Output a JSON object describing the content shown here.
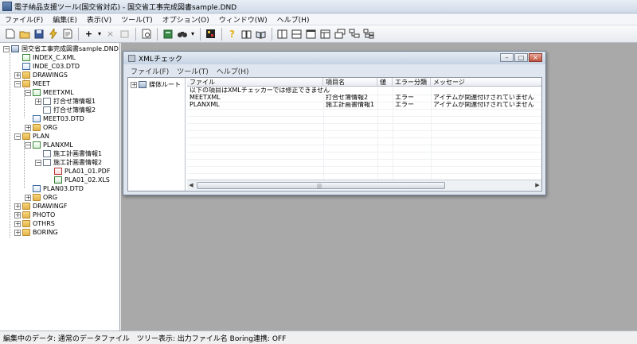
{
  "window": {
    "title": "電子納品支援ツール(国交省対応) - 国交省工事完成図書sample.DND"
  },
  "menu": [
    "ファイル(F)",
    "編集(E)",
    "表示(V)",
    "ツール(T)",
    "オプション(O)",
    "ウィンドウ(W)",
    "ヘルプ(H)"
  ],
  "toolbar": {
    "add_label": "+",
    "dropdown_arrow": "▾",
    "cancel_label": "×"
  },
  "tree": {
    "root": "国交省工事完成図書sample.DND",
    "nodes": [
      "INDEX_C.XML",
      "INDE_C03.DTD",
      "DRAWINGS",
      "MEET",
      "MEETXML",
      "打合せ簿情報1",
      "打合せ簿情報2",
      "MEET03.DTD",
      "ORG",
      "PLAN",
      "PLANXML",
      "施工計画書情報1",
      "施工計画書情報2",
      "PLA01_01.PDF",
      "PLA01_02.XLS",
      "PLAN03.DTD",
      "ORG",
      "DRAWINGF",
      "PHOTO",
      "OTHRS",
      "BORING"
    ]
  },
  "child_window": {
    "title": "XMLチェック",
    "menu": [
      "ファイル(F)",
      "ツール(T)",
      "ヘルプ(H)"
    ],
    "tree_root": "媒体ルート",
    "columns": [
      "ファイル",
      "項目名",
      "値",
      "エラー分類",
      "メッセージ"
    ],
    "rows": [
      {
        "file": "以下の項目はXMLチェッカーでは修正できません",
        "item": "",
        "value": "",
        "error": "",
        "message": ""
      },
      {
        "file": "MEETXML",
        "item": "打合せ簿情報2",
        "value": "",
        "error": "エラー",
        "message": "アイテムが関連付けされていません"
      },
      {
        "file": "PLANXML",
        "item": "施工計画書情報1",
        "value": "",
        "error": "エラー",
        "message": "アイテムが関連付けされていません"
      }
    ]
  },
  "status": {
    "text": "編集中のデータ: 通常のデータファイル　ツリー表示: 出力ファイル名  Boring連携: OFF"
  }
}
